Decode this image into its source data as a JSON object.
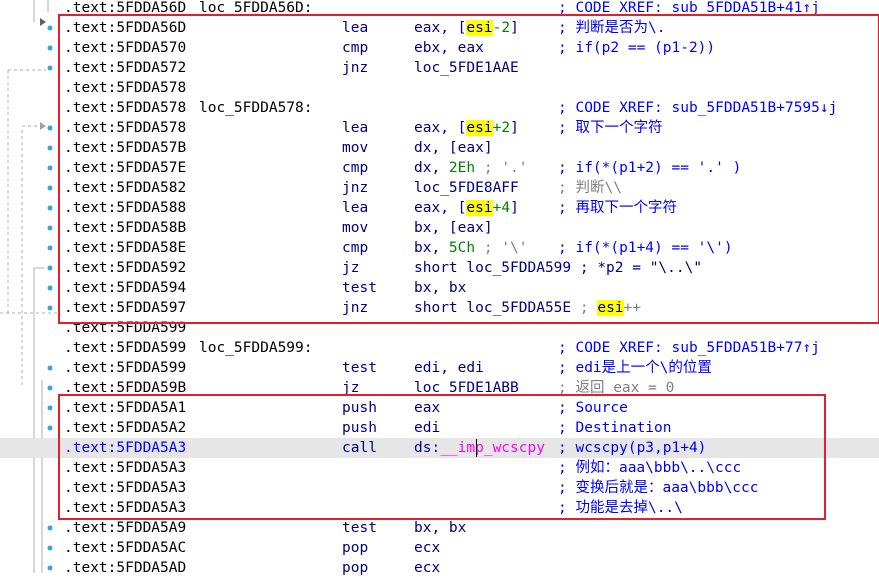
{
  "rows": [
    {
      "addr": ".text:5FDDA56D",
      "label": "loc_5FDDA56D:",
      "mnemonic": "",
      "operands": [],
      "comment": [
        {
          "t": "; CODE XREF: sub_5FDDA51B+41↑j",
          "c": "c"
        }
      ]
    },
    {
      "addr": ".text:5FDDA56D",
      "label": "",
      "mnemonic": "lea",
      "operands": [
        {
          "t": "eax, [",
          "c": "o"
        },
        {
          "t": "esi",
          "c": "r"
        },
        {
          "t": "-2",
          "c": "n"
        },
        {
          "t": "]",
          "c": "o"
        }
      ],
      "comment": [
        {
          "t": "; 判断是否为\\.",
          "c": "c"
        }
      ]
    },
    {
      "addr": ".text:5FDDA570",
      "label": "",
      "mnemonic": "cmp",
      "operands": [
        {
          "t": "ebx, eax",
          "c": "o"
        }
      ],
      "comment": [
        {
          "t": "; if(p2 == (p1-2))",
          "c": "c"
        }
      ]
    },
    {
      "addr": ".text:5FDDA572",
      "label": "",
      "mnemonic": "jnz",
      "operands": [
        {
          "t": "loc_5FDE1AAE",
          "c": "o"
        }
      ],
      "comment": []
    },
    {
      "addr": ".text:5FDDA578",
      "label": "",
      "mnemonic": "",
      "operands": [],
      "comment": []
    },
    {
      "addr": ".text:5FDDA578",
      "label": "loc_5FDDA578:",
      "mnemonic": "",
      "operands": [],
      "comment": [
        {
          "t": "; CODE XREF: sub_5FDDA51B+7595↓j",
          "c": "c"
        }
      ]
    },
    {
      "addr": ".text:5FDDA578",
      "label": "",
      "mnemonic": "lea",
      "operands": [
        {
          "t": "eax, [",
          "c": "o"
        },
        {
          "t": "esi",
          "c": "r"
        },
        {
          "t": "+2",
          "c": "n"
        },
        {
          "t": "]",
          "c": "o"
        }
      ],
      "comment": [
        {
          "t": "; 取下一个字符",
          "c": "c"
        }
      ]
    },
    {
      "addr": ".text:5FDDA57B",
      "label": "",
      "mnemonic": "mov",
      "operands": [
        {
          "t": "dx, [eax]",
          "c": "o"
        }
      ],
      "comment": []
    },
    {
      "addr": ".text:5FDDA57E",
      "label": "",
      "mnemonic": "cmp",
      "operands": [
        {
          "t": "dx, ",
          "c": "o"
        },
        {
          "t": "2Eh",
          "c": "n"
        },
        {
          "t": " ; '.'",
          "c": "s"
        }
      ],
      "comment": [
        {
          "t": "; if(*(p1+2) == '.' )",
          "c": "c"
        }
      ]
    },
    {
      "addr": ".text:5FDDA582",
      "label": "",
      "mnemonic": "jnz",
      "operands": [
        {
          "t": "loc_5FDE8AFF",
          "c": "o"
        }
      ],
      "comment": [
        {
          "t": "; 判断\\\\",
          "c": "g"
        }
      ]
    },
    {
      "addr": ".text:5FDDA588",
      "label": "",
      "mnemonic": "lea",
      "operands": [
        {
          "t": "eax, [",
          "c": "o"
        },
        {
          "t": "esi",
          "c": "r"
        },
        {
          "t": "+4",
          "c": "n"
        },
        {
          "t": "]",
          "c": "o"
        }
      ],
      "comment": [
        {
          "t": "; 再取下一个字符",
          "c": "c"
        }
      ]
    },
    {
      "addr": ".text:5FDDA58B",
      "label": "",
      "mnemonic": "mov",
      "operands": [
        {
          "t": "bx, [eax]",
          "c": "o"
        }
      ],
      "comment": []
    },
    {
      "addr": ".text:5FDDA58E",
      "label": "",
      "mnemonic": "cmp",
      "operands": [
        {
          "t": "bx, ",
          "c": "o"
        },
        {
          "t": "5Ch",
          "c": "n"
        },
        {
          "t": " ; '\\'",
          "c": "s"
        }
      ],
      "comment": [
        {
          "t": "; if(*(p1+4) == '\\')",
          "c": "c"
        }
      ]
    },
    {
      "addr": ".text:5FDDA592",
      "label": "",
      "mnemonic": "jz",
      "operands": [
        {
          "t": "short loc_5FDDA599 ; *p2 = \"\\..\\\"",
          "c": "o"
        }
      ],
      "comment": []
    },
    {
      "addr": ".text:5FDDA594",
      "label": "",
      "mnemonic": "test",
      "operands": [
        {
          "t": "bx, bx",
          "c": "o"
        }
      ],
      "comment": []
    },
    {
      "addr": ".text:5FDDA597",
      "label": "",
      "mnemonic": "jnz",
      "operands": [
        {
          "t": "short loc_5FDDA55E ",
          "c": "o"
        },
        {
          "t": "; ",
          "c": "s"
        },
        {
          "t": "esi",
          "c": "r"
        },
        {
          "t": "++",
          "c": "s"
        }
      ],
      "comment": []
    },
    {
      "addr": ".text:5FDDA599",
      "label": "",
      "mnemonic": "",
      "operands": [],
      "comment": []
    },
    {
      "addr": ".text:5FDDA599",
      "label": "loc_5FDDA599:",
      "mnemonic": "",
      "operands": [],
      "comment": [
        {
          "t": "; CODE XREF: sub_5FDDA51B+77↑j",
          "c": "c"
        }
      ]
    },
    {
      "addr": ".text:5FDDA599",
      "label": "",
      "mnemonic": "test",
      "operands": [
        {
          "t": "edi, edi",
          "c": "o"
        }
      ],
      "comment": [
        {
          "t": "; edi是上一个\\的位置",
          "c": "c"
        }
      ]
    },
    {
      "addr": ".text:5FDDA59B",
      "label": "",
      "mnemonic": "jz",
      "operands": [
        {
          "t": "loc_5FDE1ABB",
          "c": "o"
        }
      ],
      "comment": [
        {
          "t": "; 返回 eax = 0",
          "c": "g"
        }
      ]
    },
    {
      "addr": ".text:5FDDA5A1",
      "label": "",
      "mnemonic": "push",
      "operands": [
        {
          "t": "eax",
          "c": "o"
        }
      ],
      "comment": [
        {
          "t": "; Source",
          "c": "c"
        }
      ]
    },
    {
      "addr": ".text:5FDDA5A2",
      "label": "",
      "mnemonic": "push",
      "operands": [
        {
          "t": "edi",
          "c": "o"
        }
      ],
      "comment": [
        {
          "t": "; Destination",
          "c": "c"
        }
      ]
    },
    {
      "addr": ".text:5FDDA5A3",
      "label": "",
      "mnemonic": "call",
      "operands": [
        {
          "t": "ds:",
          "c": "o"
        },
        {
          "t": "__imp_wcscpy",
          "c": "y"
        }
      ],
      "comment": [
        {
          "t": "; wcscpy(p3,p1+4)",
          "c": "c"
        }
      ],
      "highlight": true
    },
    {
      "addr": ".text:5FDDA5A3",
      "label": "",
      "mnemonic": "",
      "operands": [],
      "comment": [
        {
          "t": "; 例如：aaa\\bbb\\..\\ccc",
          "c": "c"
        }
      ]
    },
    {
      "addr": ".text:5FDDA5A3",
      "label": "",
      "mnemonic": "",
      "operands": [],
      "comment": [
        {
          "t": "; 变换后就是：aaa\\bbb\\ccc",
          "c": "c"
        }
      ]
    },
    {
      "addr": ".text:5FDDA5A3",
      "label": "",
      "mnemonic": "",
      "operands": [],
      "comment": [
        {
          "t": "; 功能是去掉\\..\\",
          "c": "c"
        }
      ]
    },
    {
      "addr": ".text:5FDDA5A9",
      "label": "",
      "mnemonic": "test",
      "operands": [
        {
          "t": "bx, bx",
          "c": "o"
        }
      ],
      "comment": []
    },
    {
      "addr": ".text:5FDDA5AC",
      "label": "",
      "mnemonic": "pop",
      "operands": [
        {
          "t": "ecx",
          "c": "o"
        }
      ],
      "comment": []
    },
    {
      "addr": ".text:5FDDA5AD",
      "label": "",
      "mnemonic": "pop",
      "operands": [
        {
          "t": "ecx",
          "c": "o"
        }
      ],
      "comment": []
    }
  ],
  "colors": {
    "address": "#000000",
    "current_line_address": "#0000ff",
    "mnemonic": "#000080",
    "comment": "#0000ff",
    "register_highlight": "#ffff00",
    "immediate": "#008000",
    "import_symbol": "#ff00ff",
    "frame": "#e0202a",
    "arrows": "#a0a0a0"
  }
}
